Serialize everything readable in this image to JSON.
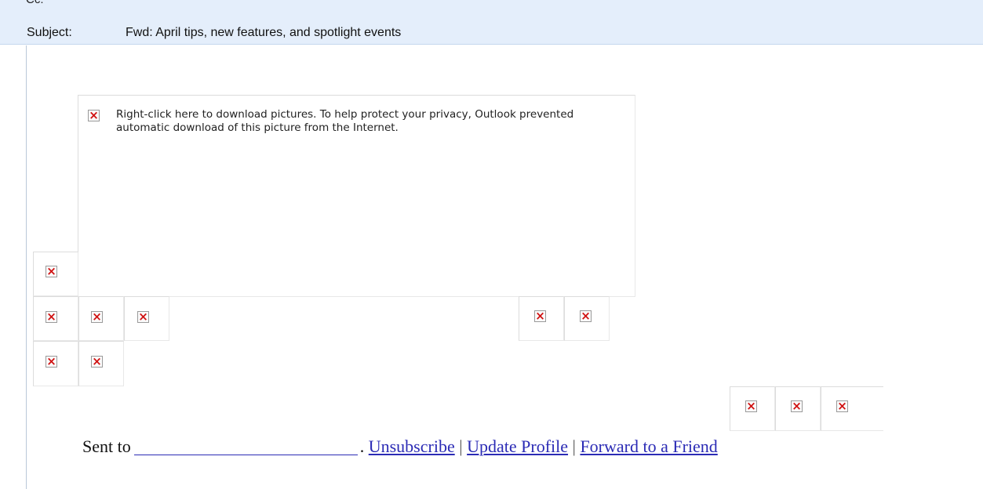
{
  "header": {
    "cc_label": "Cc:",
    "subject_label": "Subject:",
    "subject_value": "Fwd: April tips, new features, and spotlight events"
  },
  "message": {
    "blocked_image_notice": "Right-click here to download pictures.  To help protect your privacy, Outlook prevented automatic download of this picture from the Internet.",
    "footer": {
      "sent_to": "Sent to",
      "unsubscribe": "Unsubscribe",
      "update_profile": "Update Profile",
      "forward": "Forward to a Friend",
      "separator": "|",
      "period": "."
    }
  },
  "icons": {
    "blocked_image": "broken-image-x-icon"
  },
  "colors": {
    "header_bg": "#e4eefb",
    "link": "#2b2bb5",
    "x_mark": "#d01010"
  }
}
